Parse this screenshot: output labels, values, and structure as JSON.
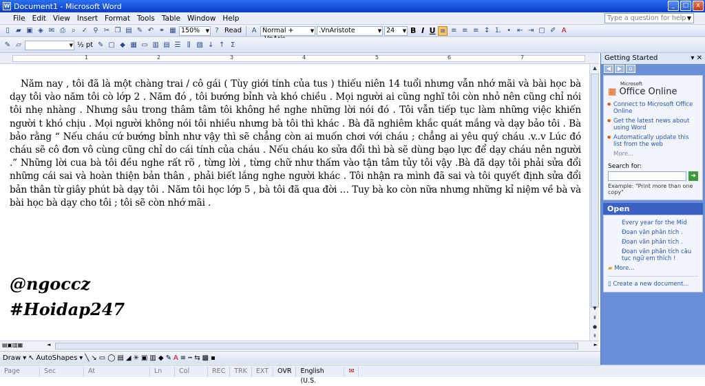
{
  "window": {
    "title": "Document1 - Microsoft Word",
    "min": "_",
    "max": "□",
    "close": "x"
  },
  "menu": {
    "items": [
      "File",
      "Edit",
      "View",
      "Insert",
      "Format",
      "Tools",
      "Table",
      "Window",
      "Help"
    ],
    "question_placeholder": "Type a question for help"
  },
  "toolbar1": {
    "zoom": "150%",
    "read": "Read",
    "style": "Normal + .VnAris",
    "font": ".VnAristote",
    "size": "24",
    "bold": "B",
    "italic": "I",
    "underline": "U"
  },
  "toolbar2": {
    "line_weight": "½ pt"
  },
  "ruler": {
    "numbers": [
      "1",
      "2",
      "3",
      "4",
      "5",
      "6",
      "7"
    ]
  },
  "document": {
    "paragraph": "Năm nay , tôi đã là một chàng trai / cô gái ( Tùy giới tính của tus ) thiếu niên 14 tuổi nhưng vẫn nhớ mãi và bài học bà dạy tôi vào năm tôi cò lớp 2 . Năm đó , tôi bướng bỉnh và khó chiều . Mọi người ai cũng nghĩ tôi còn nhỏ nên cũng chỉ nói tôi nhẹ nhàng . Nhưng sâu trong thâm tâm tôi không hề nghe những lời nói đó . Tôi vẫn tiếp tục làm những việc khiến người t khó chịu . Mọi người không nói tôi nhiều nhưng bà tôi thì khác . Bà đã nghiêm khắc quát mắng và dạy bảo tôi . Bà bảo rằng “ Nếu cháu cứ bướng bỉnh như vậy thì sẽ chẳng còn ai muốn chơi với cháu ; chẳng ai yêu quý cháu .v..v Lúc đó cháu sẽ cô đơn vô cùng cũng chỉ do cái tính của cháu . Nếu cháu ko sửa đổi thì bà sẽ dùng bạo lực để dạy cháu nên người .” Những lời cua bà tôi đều nghe rất rõ , từng lời , từng chữ như thấm vào tận tâm tủy tôi vậy .Bà đã dạy tôi phải sửa đổi những cái sai và hoàn thiện bản thân , phải biết lắng nghe người khác . Tôi nhận ra mình đã sai và tôi quyết định sửa đổi bản thân từ giây phút bà dạy tôi . Năm tôi học lớp 5 , bà tôi đã qua đời … Tuy bà ko còn nữa nhưng những kỉ niệm về bà và bài học bà dạy cho tôi ; tôi sẽ còn nhớ mãi .",
    "sig1": "@ngoccz",
    "sig2": "#Hoidap247"
  },
  "drawbar": {
    "draw": "Draw",
    "autoshapes": "AutoShapes"
  },
  "status": {
    "page": "Page",
    "sec": "Sec",
    "at": "At",
    "ln": "Ln",
    "col": "Col",
    "rec": "REC",
    "trk": "TRK",
    "ext": "EXT",
    "ovr": "OVR",
    "lang": "English (U.S."
  },
  "pane": {
    "title": "Getting Started",
    "office_prefix": "Microsoft",
    "office": "Office Online",
    "links": [
      "Connect to Microsoft Office Online",
      "Get the latest news about using Word",
      "Automatically update this list from the web"
    ],
    "more": "More...",
    "search_label": "Search for:",
    "example": "Example:  \"Print more than one copy\"",
    "open_title": "Open",
    "open_items": [
      "Every year for the Mid",
      "Đoạn văn phân tích .",
      "Đoạn văn phân tích .",
      "Đoạn văn phân tích câu tục ngữ em thích !"
    ],
    "open_more": "More...",
    "create": "Create a new document..."
  }
}
